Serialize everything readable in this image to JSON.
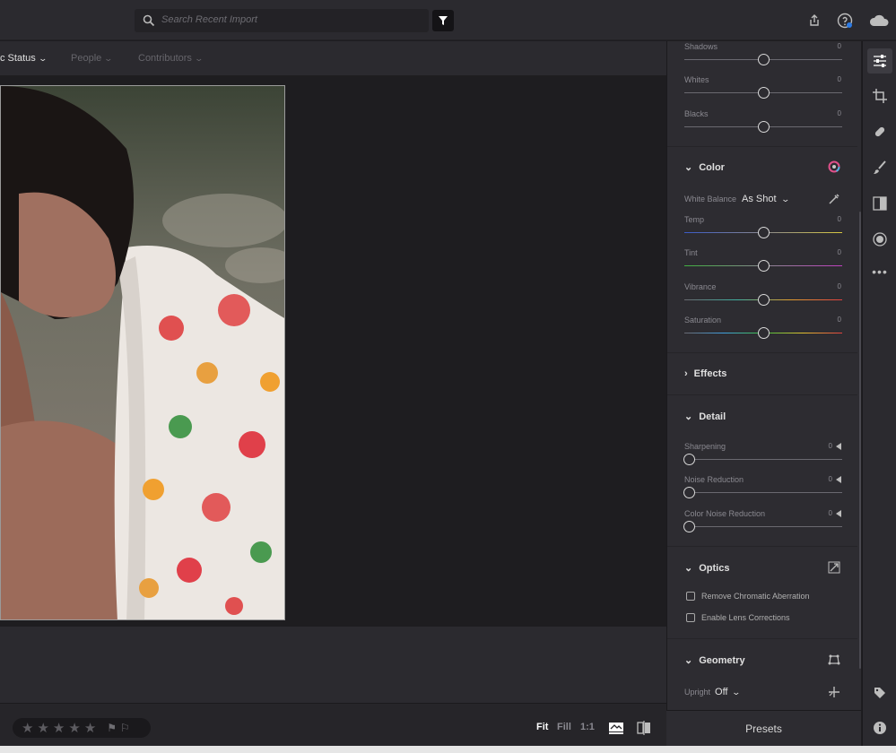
{
  "search": {
    "placeholder": "Search Recent Import"
  },
  "filters": {
    "status": "c Status",
    "people": "People",
    "contributors": "Contributors"
  },
  "light": {
    "shadows": {
      "label": "Shadows",
      "value": "0"
    },
    "whites": {
      "label": "Whites",
      "value": "0"
    },
    "blacks": {
      "label": "Blacks",
      "value": "0"
    }
  },
  "color": {
    "title": "Color",
    "wb_label": "White Balance",
    "wb_value": "As Shot",
    "temp": {
      "label": "Temp",
      "value": "0"
    },
    "tint": {
      "label": "Tint",
      "value": "0"
    },
    "vibrance": {
      "label": "Vibrance",
      "value": "0"
    },
    "saturation": {
      "label": "Saturation",
      "value": "0"
    }
  },
  "effects": {
    "title": "Effects"
  },
  "detail": {
    "title": "Detail",
    "sharpening": {
      "label": "Sharpening",
      "value": "0"
    },
    "noise": {
      "label": "Noise Reduction",
      "value": "0"
    },
    "color_noise": {
      "label": "Color Noise Reduction",
      "value": "0"
    }
  },
  "optics": {
    "title": "Optics",
    "chromatic": "Remove Chromatic Aberration",
    "lens": "Enable Lens Corrections"
  },
  "geometry": {
    "title": "Geometry",
    "upright_label": "Upright",
    "upright_value": "Off"
  },
  "bottom": {
    "fit": "Fit",
    "fill": "Fill",
    "one_to_one": "1:1",
    "presets": "Presets"
  },
  "colors": {
    "bg": "#1e1d20",
    "panel": "#2d2c31",
    "accent": "#ffffff"
  }
}
